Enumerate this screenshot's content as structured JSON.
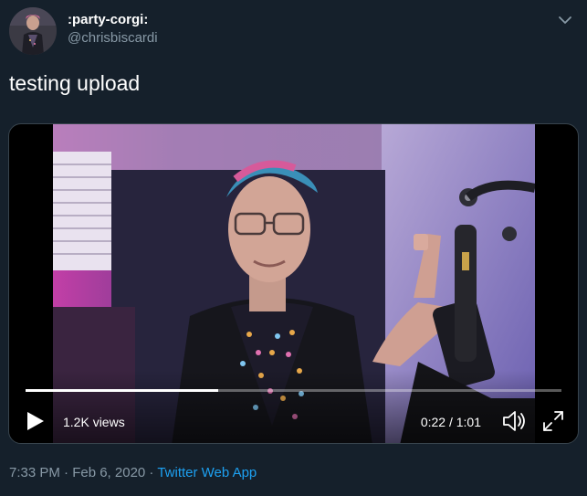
{
  "tweet": {
    "display_name": ":party-corgi:",
    "handle": "@chrisbiscardi",
    "text": "testing upload",
    "timestamp": "7:33 PM · Feb 6, 2020 ·",
    "source": "Twitter Web App"
  },
  "video": {
    "views": "1.2K views",
    "time": "0:22 / 1:01",
    "progress_fraction": 0.36
  },
  "icons": {
    "caret": "chevron-down-icon",
    "play": "play-icon",
    "volume": "volume-icon",
    "fullscreen": "fullscreen-icon"
  },
  "colors": {
    "background": "#15202b",
    "secondary_text": "#8899a6",
    "link": "#1da1f2",
    "border": "#38444d"
  }
}
